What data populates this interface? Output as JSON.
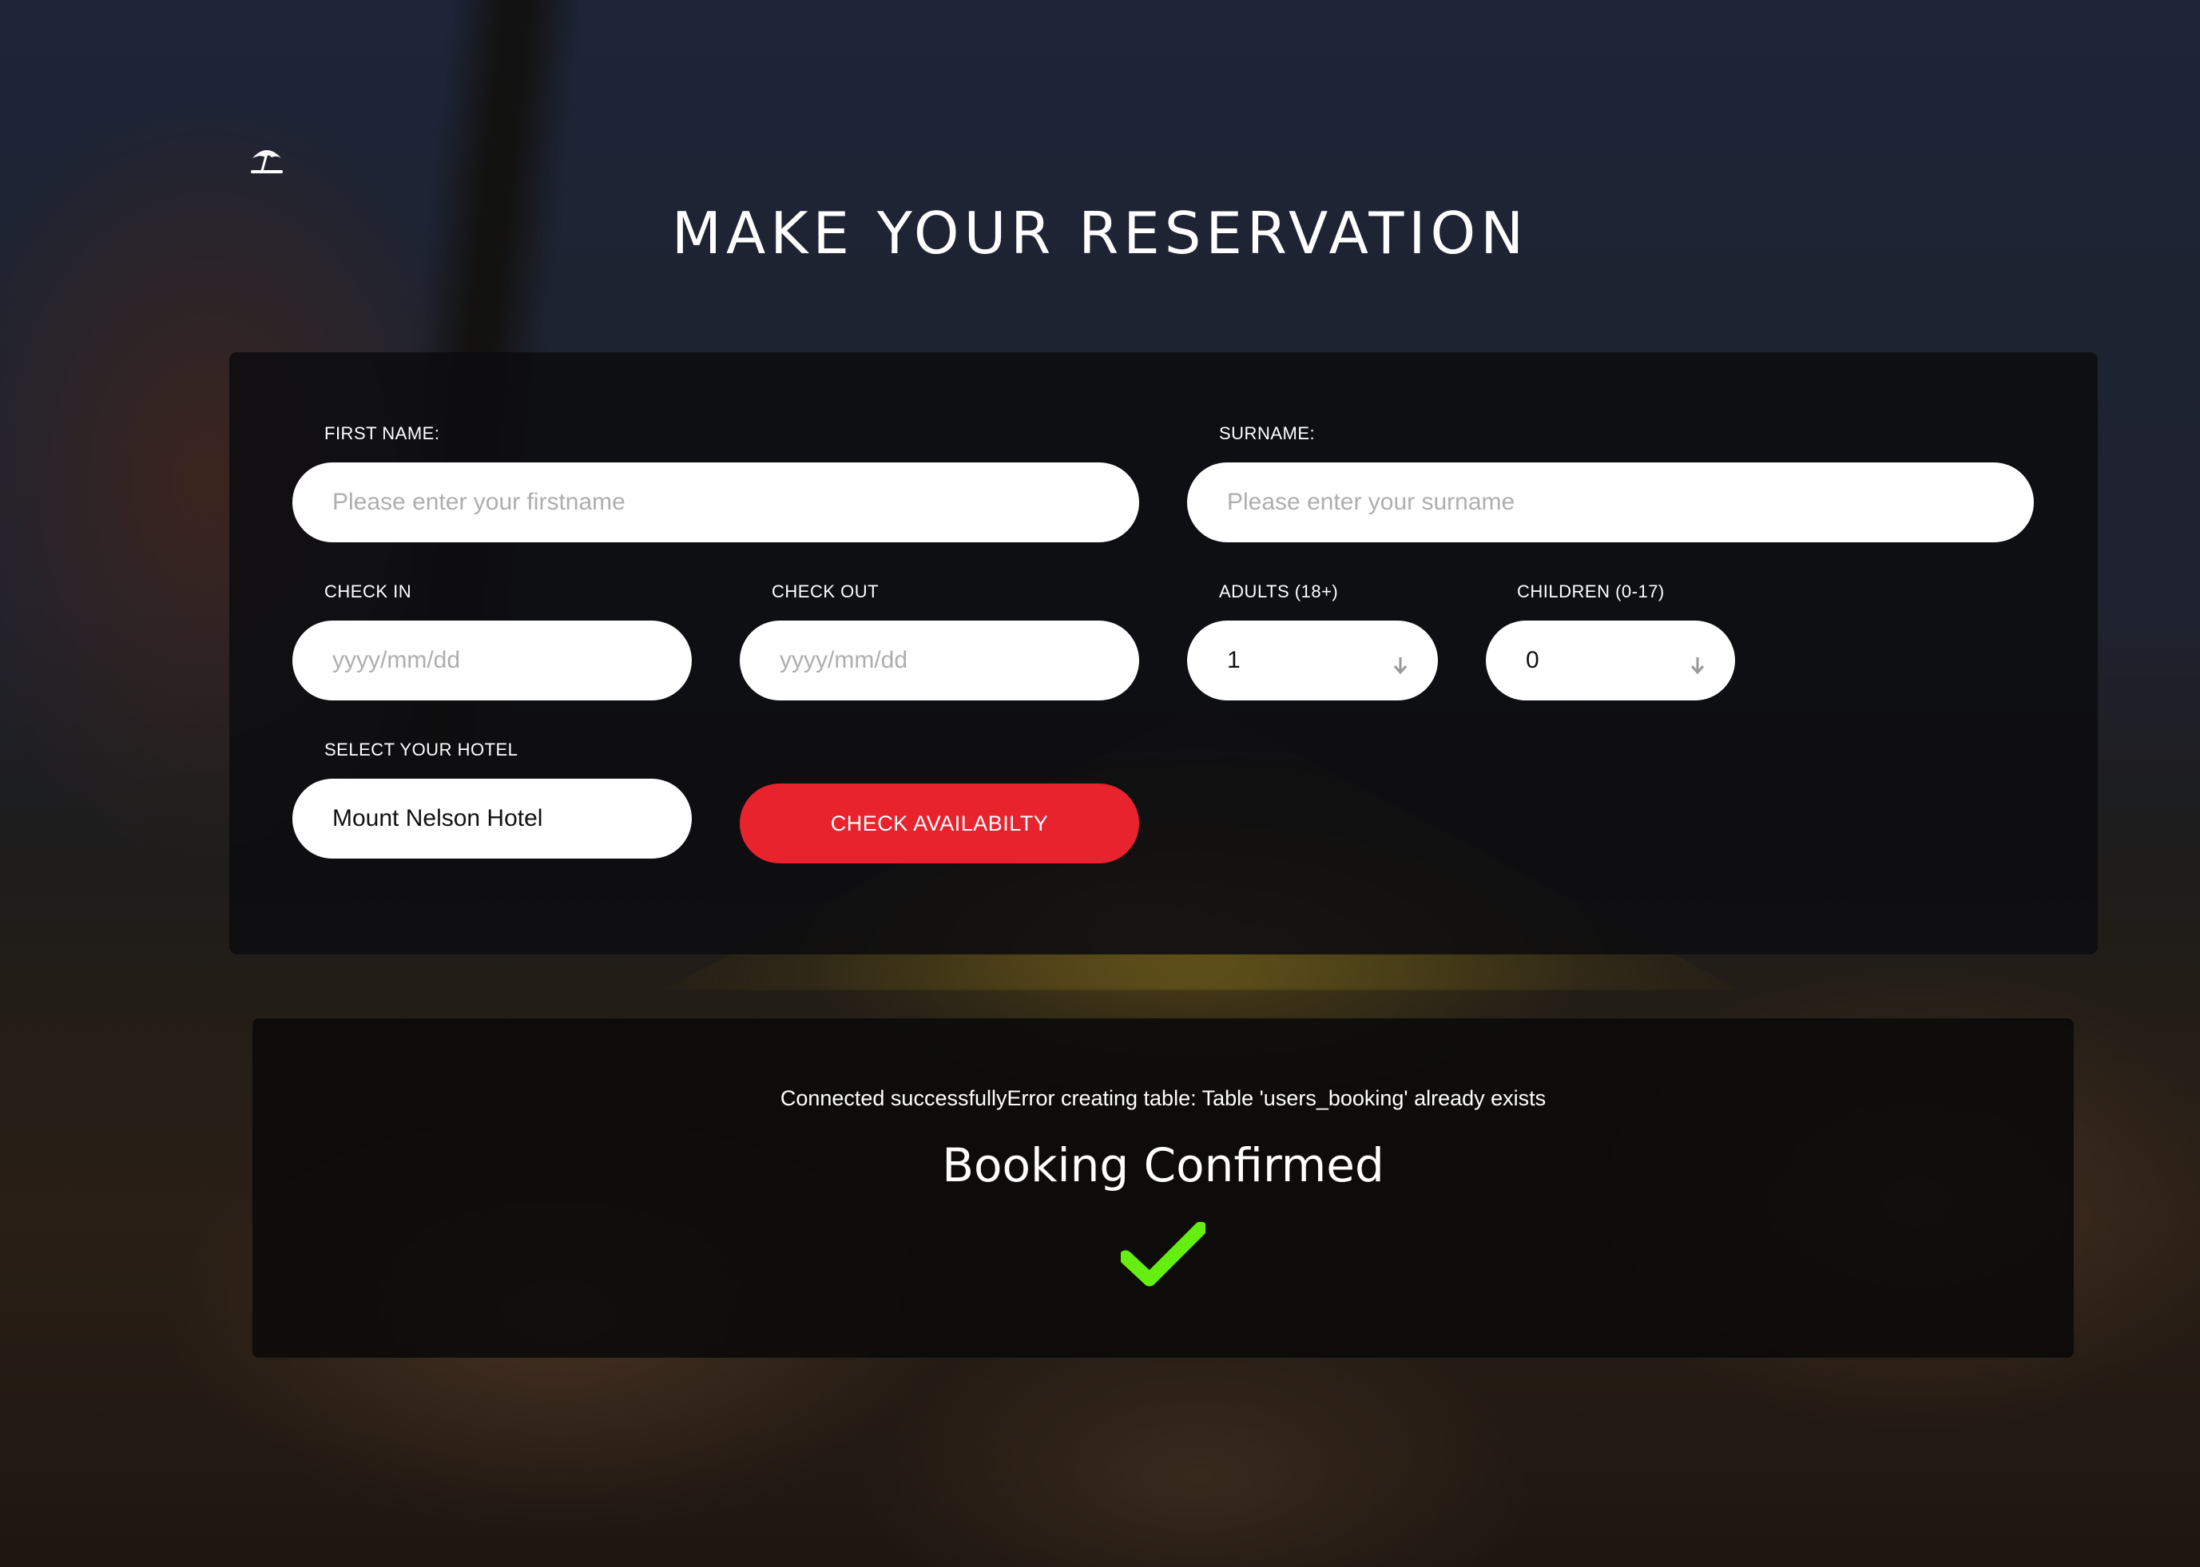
{
  "page": {
    "title": "MAKE YOUR RESERVATION",
    "logo_icon": "beach-umbrella-icon"
  },
  "form": {
    "first_name": {
      "label": "FIRST NAME:",
      "placeholder": "Please enter your firstname",
      "value": ""
    },
    "surname": {
      "label": "SURNAME:",
      "placeholder": "Please enter your surname",
      "value": ""
    },
    "check_in": {
      "label": "CHECK IN",
      "placeholder": "yyyy/mm/dd",
      "value": ""
    },
    "check_out": {
      "label": "CHECK OUT",
      "placeholder": "yyyy/mm/dd",
      "value": ""
    },
    "adults": {
      "label": "ADULTS (18+)",
      "value": "1"
    },
    "children": {
      "label": "CHILDREN (0-17)",
      "value": "0"
    },
    "hotel": {
      "label": "SELECT YOUR HOTEL",
      "value": "Mount Nelson Hotel"
    },
    "submit_label": "CHECK AVAILABILTY"
  },
  "result": {
    "status_message": "Connected successfullyError creating table: Table 'users_booking' already exists",
    "title": "Booking Confirmed",
    "icon": "checkmark-icon",
    "icon_color": "#66ee11"
  },
  "colors": {
    "accent": "#e8232e",
    "panel": "#0c0d0f",
    "success": "#66ee11"
  }
}
